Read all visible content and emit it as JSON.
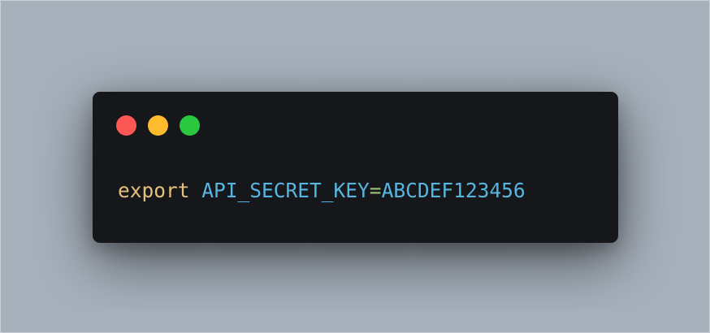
{
  "colors": {
    "background": "#a7b1bc",
    "window": "#16171a",
    "close": "#fd5753",
    "minimize": "#febb2e",
    "maximize": "#29c83f",
    "keyword": "#e6c07b",
    "identifier": "#56b6e2",
    "operator": "#98c379"
  },
  "window": {
    "buttons": [
      {
        "icon": "close-dot-icon"
      },
      {
        "icon": "minimize-dot-icon"
      },
      {
        "icon": "maximize-dot-icon"
      }
    ]
  },
  "code": {
    "keyword": "export",
    "space": " ",
    "variable": "API_SECRET_KEY",
    "operator": "=",
    "value": "ABCDEF123456"
  }
}
